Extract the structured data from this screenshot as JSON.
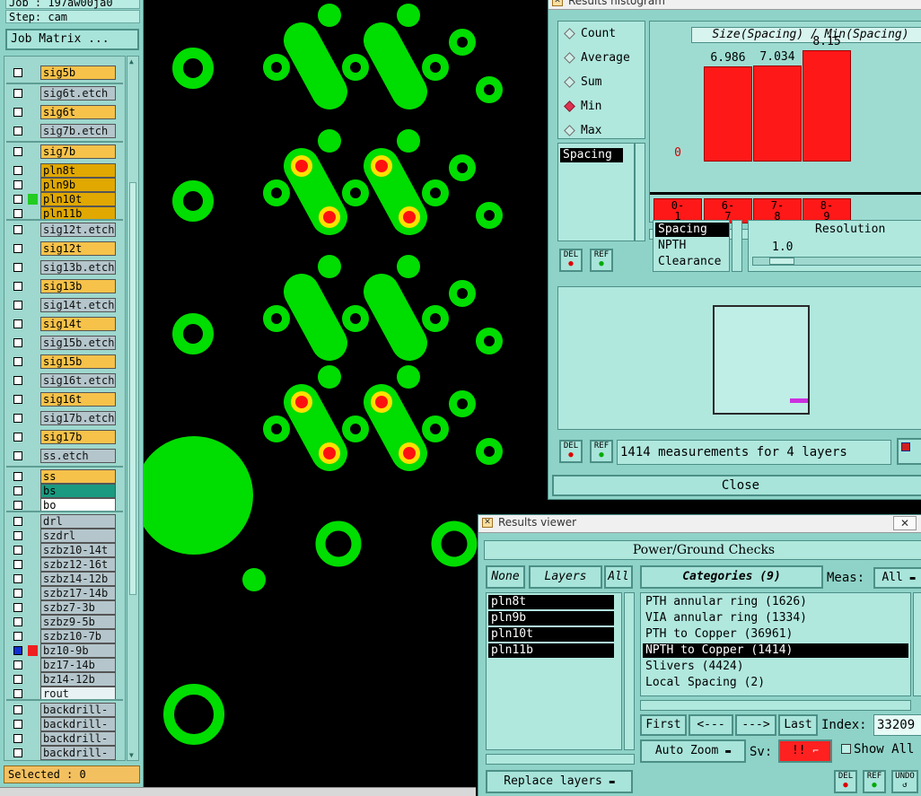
{
  "left_panel": {
    "job_line": "Job : 197aw00ja0",
    "step_line": "Step: cam",
    "job_matrix_label": "Job Matrix ...",
    "selected_label": "Selected : 0",
    "layers": [
      {
        "name": "sig5b",
        "style": "orange"
      },
      {
        "name": "sig6t.etch",
        "style": "gray"
      },
      {
        "name": "sig6t",
        "style": "orange"
      },
      {
        "name": "sig7b.etch",
        "style": "gray"
      },
      {
        "name": "sig7b",
        "style": "orange"
      },
      {
        "name": "pln8t",
        "style": "gold"
      },
      {
        "name": "pln9b",
        "style": "gold"
      },
      {
        "name": "pln10t",
        "style": "gold"
      },
      {
        "name": "pln11b",
        "style": "gold"
      },
      {
        "name": "sig12t.etch",
        "style": "gray"
      },
      {
        "name": "sig12t",
        "style": "orange"
      },
      {
        "name": "sig13b.etch",
        "style": "gray"
      },
      {
        "name": "sig13b",
        "style": "orange"
      },
      {
        "name": "sig14t.etch",
        "style": "gray"
      },
      {
        "name": "sig14t",
        "style": "orange"
      },
      {
        "name": "sig15b.etch",
        "style": "gray"
      },
      {
        "name": "sig15b",
        "style": "orange"
      },
      {
        "name": "sig16t.etch",
        "style": "gray"
      },
      {
        "name": "sig16t",
        "style": "orange"
      },
      {
        "name": "sig17b.etch",
        "style": "gray"
      },
      {
        "name": "sig17b",
        "style": "orange"
      },
      {
        "name": "ss.etch",
        "style": "gray"
      },
      {
        "name": "ss",
        "style": "orange"
      },
      {
        "name": "bs",
        "style": "teal"
      },
      {
        "name": "bo",
        "style": "white"
      },
      {
        "name": "drl",
        "style": "gray"
      },
      {
        "name": "szdrl",
        "style": "gray"
      },
      {
        "name": "szbz10-14t",
        "style": "gray"
      },
      {
        "name": "szbz12-16t",
        "style": "gray"
      },
      {
        "name": "szbz14-12b",
        "style": "gray"
      },
      {
        "name": "szbz17-14b",
        "style": "gray"
      },
      {
        "name": "szbz7-3b",
        "style": "gray"
      },
      {
        "name": "szbz9-5b",
        "style": "gray"
      },
      {
        "name": "szbz10-7b",
        "style": "gray"
      },
      {
        "name": "bz10-9b",
        "style": "gray"
      },
      {
        "name": "bz17-14b",
        "style": "gray"
      },
      {
        "name": "bz14-12b",
        "style": "gray"
      },
      {
        "name": "rout",
        "style": "light"
      },
      {
        "name": "backdrill-",
        "style": "gray"
      },
      {
        "name": "backdrill-",
        "style": "gray"
      },
      {
        "name": "backdrill-",
        "style": "gray"
      },
      {
        "name": "backdrill-",
        "style": "gray"
      }
    ],
    "colors": {
      "orange": "#f6c24a",
      "gold": "#e0a800",
      "gray": "#b4c6cc",
      "teal": "#1a9a80",
      "white": "#ffffff",
      "light": "#e8f2f4"
    }
  },
  "histogram": {
    "title": "Results histogram",
    "plot_title": "Size(Spacing) / Min(Spacing)",
    "modes": [
      "Count",
      "Average",
      "Sum",
      "Min",
      "Max"
    ],
    "selected_mode": "Min",
    "measure_list": [
      "Spacing"
    ],
    "measure_types": [
      "Spacing",
      "NPTH",
      "Clearance"
    ],
    "resolution_label": "Resolution",
    "resolution_value": "1.0",
    "del_label": "DEL",
    "ref_label": "REF",
    "measurements_text": "1414 measurements for 4 layers",
    "close_label": "Close",
    "chart_data": {
      "type": "bar",
      "title": "Size(Spacing) / Min(Spacing)",
      "categories": [
        "0-1",
        "6-7",
        "7-8",
        "8-9"
      ],
      "values": [
        0,
        6.986,
        7.034,
        8.15
      ],
      "value_labels": [
        "0",
        "6.986",
        "7.034",
        "8.15"
      ],
      "ylim": [
        0,
        8.15
      ],
      "bar_color": "#ff1818"
    }
  },
  "viewer": {
    "title": "Results viewer",
    "section_title": "Power/Ground Checks",
    "none_label": "None",
    "layers_label": "Layers",
    "all_label": "All",
    "layer_items": [
      "pln8t",
      "pln9b",
      "pln10t",
      "pln11b"
    ],
    "categories_label": "Categories (9)",
    "meas_label": "Meas:",
    "meas_value": "All",
    "categories": [
      "PTH annular ring (1626)",
      "VIA annular ring (1334)",
      "PTH to Copper (36961)",
      "NPTH to Copper (1414)",
      "Slivers (4424)",
      "Local Spacing (2)"
    ],
    "selected_category": "NPTH to Copper (1414)",
    "first_label": "First",
    "prev_label": "<---",
    "next_label": "--->",
    "last_label": "Last",
    "index_label": "Index:",
    "index_value": "33209",
    "auto_zoom_label": "Auto Zoom",
    "sv_label": "Sv:",
    "sv_value": "!!",
    "show_all_label": "Show All",
    "replace_layers_label": "Replace layers",
    "del_label": "DEL",
    "ref_label": "REF",
    "undo_label": "UNDO"
  }
}
